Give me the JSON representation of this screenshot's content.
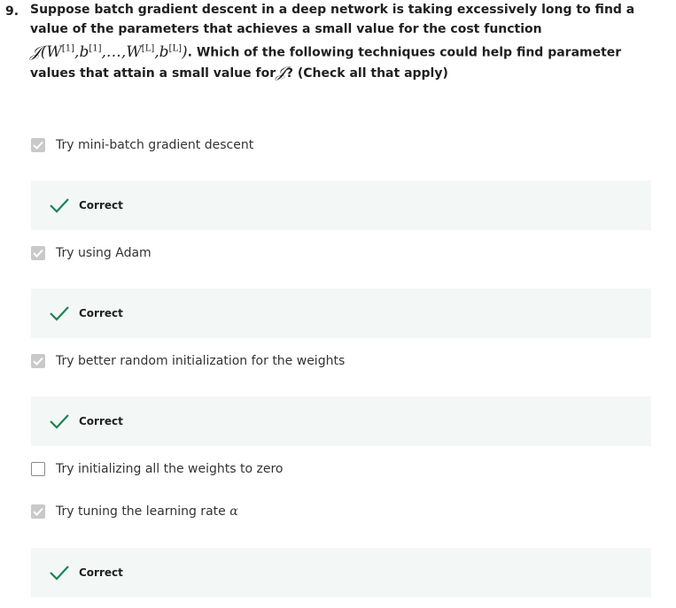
{
  "question": {
    "number": "9.",
    "text_before_formula": "Suppose batch gradient descent in a deep network is taking excessively long to find a value of the parameters that achieves a small value for the cost function ",
    "text_after_formula": ". Which of the following techniques could help find parameter values that attain a small value for",
    "text_end": "? (Check all that apply)",
    "formula_J": "𝒥",
    "formula_open": "(",
    "w1_base": "W",
    "w1_sup": "[1]",
    "sep1": ",",
    "b1_base": "b",
    "b1_sup": "[1]",
    "sep2": ",…,",
    "wl_base": "W",
    "wl_sup": "[L]",
    "sep3": ",",
    "bl_base": "b",
    "bl_sup": "[L]",
    "formula_close": ")",
    "j_symbol": "𝒥"
  },
  "options": [
    {
      "label": "Try mini-batch gradient descent",
      "checked": true,
      "feedback": "Correct"
    },
    {
      "label": "Try using Adam",
      "checked": true,
      "feedback": "Correct"
    },
    {
      "label": "Try better random initialization for the weights",
      "checked": true,
      "feedback": "Correct"
    },
    {
      "label": "Try initializing all the weights to zero",
      "checked": false,
      "feedback": ""
    },
    {
      "label": "Try tuning the learning rate ",
      "alpha": "α",
      "checked": true,
      "feedback": "Correct"
    }
  ],
  "colors": {
    "correct_green": "#1f8354",
    "feedback_bg": "#f3f8f6",
    "checkbox_checked": "#c9c9c9"
  }
}
